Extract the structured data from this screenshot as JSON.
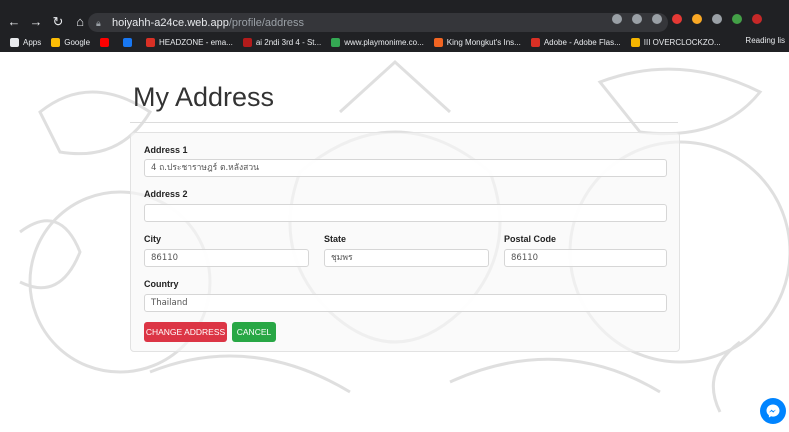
{
  "browser": {
    "url_host": "hoiyahh-a24ce.web.app",
    "url_path": "/profile/address",
    "bookmarks": [
      {
        "label": "Apps",
        "color": "#e8eaed"
      },
      {
        "label": "Google",
        "color": "#fbbc05"
      },
      {
        "label": "",
        "color": "#ff0000"
      },
      {
        "label": "",
        "color": "#1877f2"
      },
      {
        "label": "HEADZONE - ema...",
        "color": "#d93025"
      },
      {
        "label": "ai 2ndi 3rd  4 - St...",
        "color": "#b31b1b"
      },
      {
        "label": "www.playmonime.co...",
        "color": "#34a853"
      },
      {
        "label": "King Mongkut's Ins...",
        "color": "#f26522"
      },
      {
        "label": "Adobe - Adobe Flas...",
        "color": "#d93025"
      },
      {
        "label": "III OVERCLOCKZO...",
        "color": "#f4b400"
      }
    ],
    "reading_list": "Reading lis"
  },
  "page": {
    "title": "My Address",
    "form": {
      "address1_label": "Address 1",
      "address1_value": "4 ถ.ประชาราษฎร์ ต.หลังสวน",
      "address2_label": "Address 2",
      "address2_value": "",
      "city_label": "City",
      "city_value": "86110",
      "state_label": "State",
      "state_value": "ชุมพร",
      "postal_label": "Postal Code",
      "postal_value": "86110",
      "country_label": "Country",
      "country_value": "Thailand"
    },
    "buttons": {
      "change": "CHANGE ADDRESS",
      "cancel": "CANCEL"
    }
  }
}
